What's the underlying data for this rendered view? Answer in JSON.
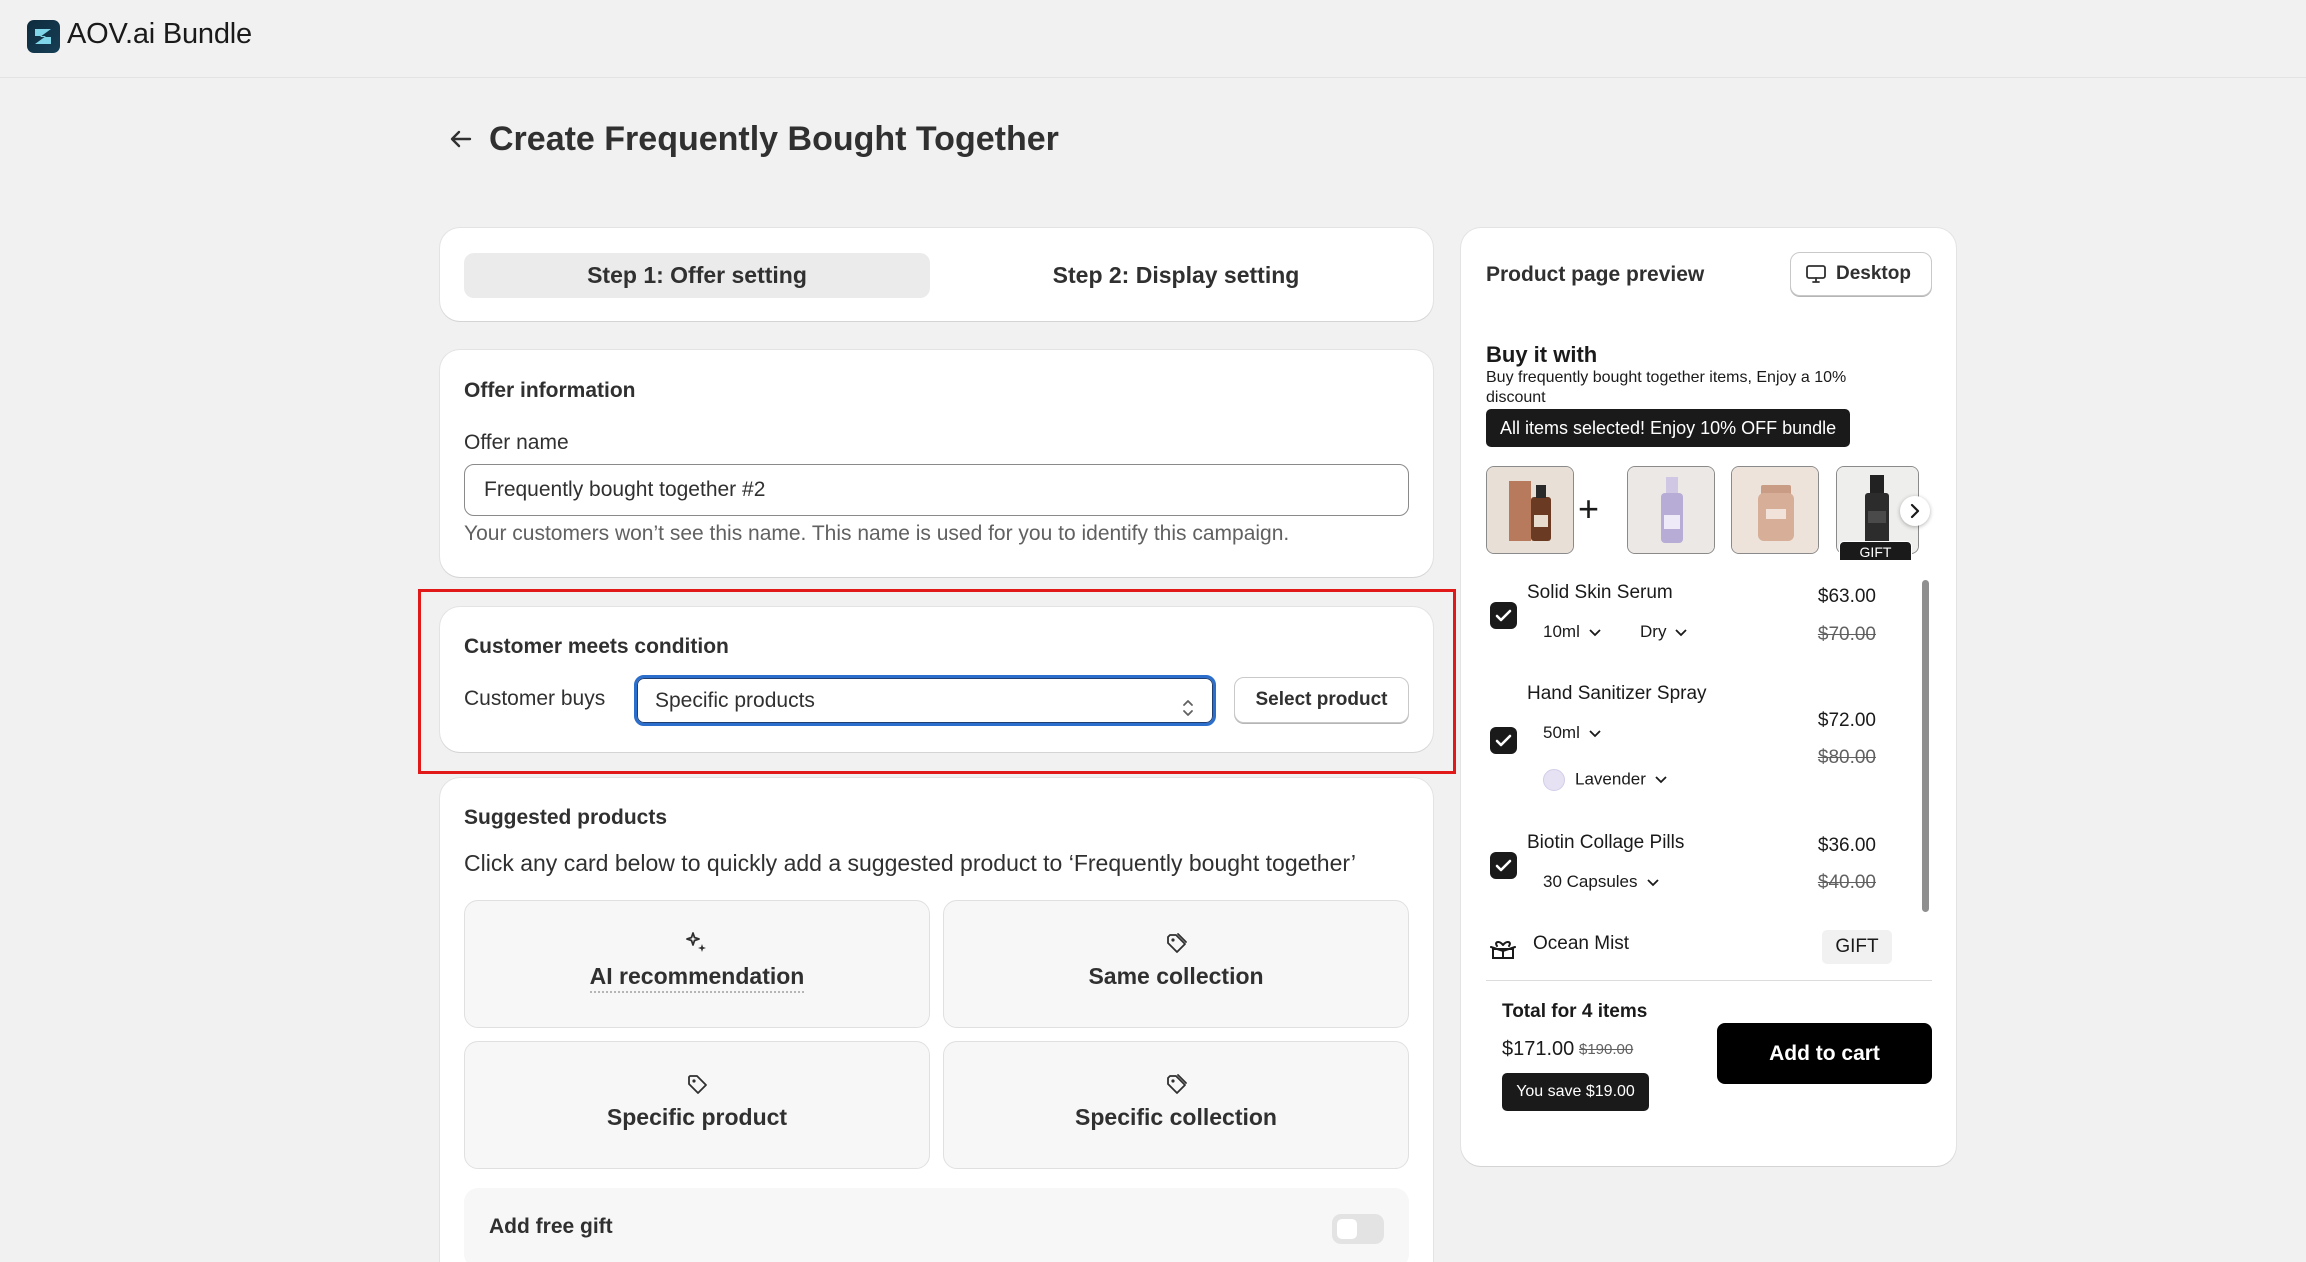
{
  "app": {
    "title": "AOV.ai Bundle"
  },
  "page": {
    "title": "Create Frequently Bought Together"
  },
  "steps": [
    {
      "label": "Step 1: Offer setting",
      "active": true
    },
    {
      "label": "Step 2: Display setting",
      "active": false
    }
  ],
  "offer": {
    "section_title": "Offer information",
    "name_label": "Offer name",
    "name_value": "Frequently bought together #2",
    "help_text": "Your customers won’t see this name. This name is used for you to identify this campaign."
  },
  "condition": {
    "section_title": "Customer meets condition",
    "label": "Customer buys",
    "selected": "Specific products",
    "button": "Select product"
  },
  "suggested": {
    "section_title": "Suggested products",
    "description": "Click any card below to quickly add a suggested product to ‘Frequently bought together’",
    "tiles": [
      {
        "label": "AI recommendation",
        "icon": "sparkle-icon"
      },
      {
        "label": "Same collection",
        "icon": "tags-icon"
      },
      {
        "label": "Specific product",
        "icon": "tag-icon"
      },
      {
        "label": "Specific collection",
        "icon": "tags-icon"
      }
    ],
    "gift_label": "Add free gift",
    "gift_enabled": false
  },
  "preview": {
    "title": "Product page preview",
    "device_button": "Desktop",
    "widget_title": "Buy it with",
    "widget_subtitle": "Buy frequently bought together items, Enjoy a 10% discount",
    "banner": "All items selected! Enjoy 10% OFF bundle",
    "gift_tag": "GIFT",
    "items": [
      {
        "name": "Solid Skin Serum",
        "variants": [
          "10ml",
          "Dry"
        ],
        "price": "$63.00",
        "old_price": "$70.00",
        "checked": true
      },
      {
        "name": "Hand Sanitizer Spray",
        "variants": [
          "50ml",
          "Lavender"
        ],
        "price": "$72.00",
        "old_price": "$80.00",
        "checked": true
      },
      {
        "name": "Biotin Collage Pills",
        "variants": [
          "30 Capsules"
        ],
        "price": "$36.00",
        "old_price": "$40.00",
        "checked": true
      }
    ],
    "gift_item": {
      "name": "Ocean Mist",
      "badge": "GIFT"
    },
    "total_label": "Total for 4 items",
    "total_price": "$171.00",
    "total_old_price": "$190.00",
    "savings": "You save $19.00",
    "cta": "Add to cart"
  },
  "colors": {
    "highlight": "#e11919",
    "focus": "#2c6ecb",
    "primary": "#000000"
  }
}
